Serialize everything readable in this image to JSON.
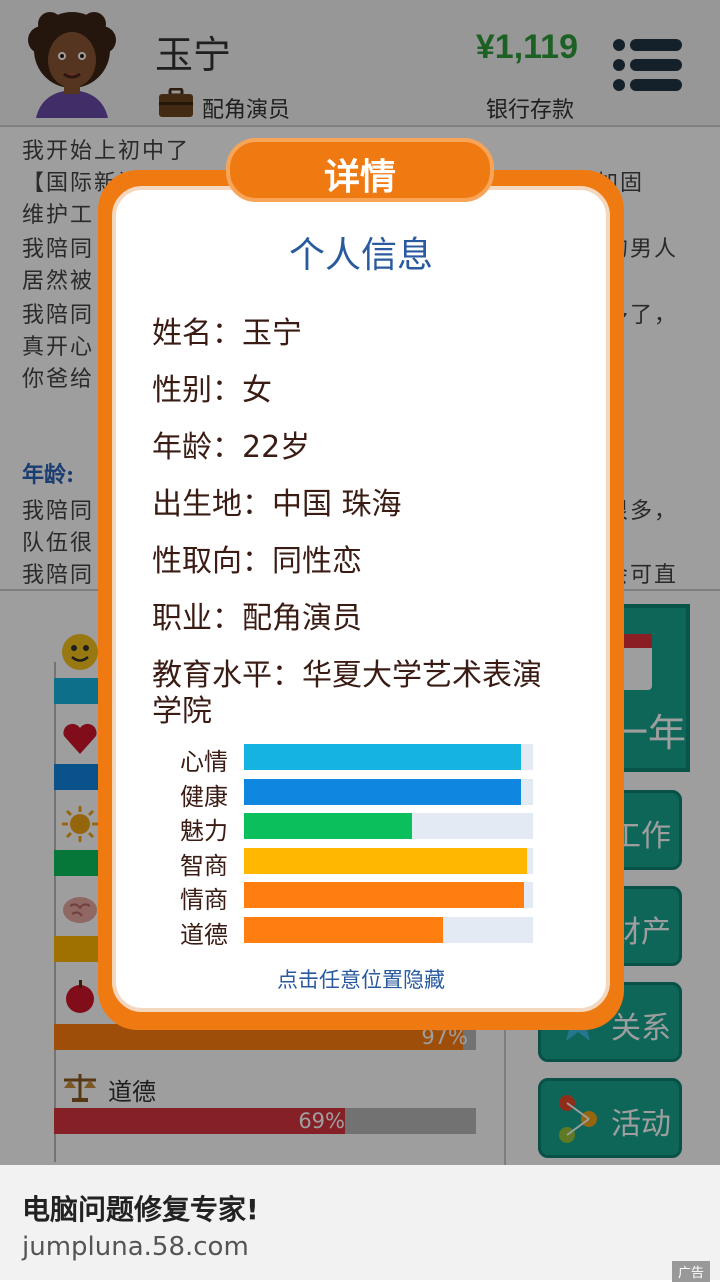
{
  "header": {
    "player_name": "玉宁",
    "job": "配角演员",
    "money": "¥1,119",
    "money_label": "银行存款"
  },
  "log": {
    "lines": [
      "我开始上初中了",
      "【国际新闻】",
      "维护工",
      "我陪同",
      "居然被",
      "我陪同",
      "真开心",
      "你爸给"
    ],
    "lines_right": [
      "乡桥梁加固",
      "的男人",
      "多了，"
    ],
    "age_heading": "年龄:",
    "lines2": [
      "我陪同",
      "队伍很",
      "我陪同"
    ],
    "lines2_right": [
      "很多，",
      "会可直"
    ]
  },
  "stats_panel": {
    "stats": [
      {
        "name": "心情",
        "icon": "smiley-icon",
        "value": 96,
        "color": "#15b3df"
      },
      {
        "name": "健康",
        "icon": "heart-icon",
        "value": 96,
        "color": "#0f86df"
      },
      {
        "name": "魅力",
        "icon": "sun-icon",
        "value": 58,
        "color": "#0bbf5d"
      },
      {
        "name": "智商",
        "icon": "brain-icon",
        "value": 98,
        "color": "#ffb700"
      },
      {
        "name": "情商",
        "icon": "apple-icon",
        "value": 97,
        "color": "#ff7e0f"
      },
      {
        "name": "道德",
        "icon": "scales-icon",
        "value": 69,
        "color": "#d8343f"
      }
    ],
    "visible_pcts": {
      "eq": "97%",
      "moral": "69%"
    },
    "moral_label": "道德"
  },
  "side_buttons": {
    "year": "一年",
    "work": "工作",
    "assets": "财产",
    "relations": "关系",
    "activities": "活动"
  },
  "dialog": {
    "tab": "详情",
    "title": "个人信息",
    "info": [
      "姓名：玉宁",
      "性别：女",
      "年龄：22岁",
      "出生地：中国 珠海",
      "性取向：同性恋",
      "职业：配角演员",
      "教育水平：华夏大学艺术表演",
      "学院"
    ],
    "stats": [
      {
        "name": "心情",
        "value": 96,
        "color": "#15b3df"
      },
      {
        "name": "健康",
        "value": 96,
        "color": "#0f86df"
      },
      {
        "name": "魅力",
        "value": 58,
        "color": "#0bbf5d"
      },
      {
        "name": "智商",
        "value": 98,
        "color": "#ffb700"
      },
      {
        "name": "情商",
        "value": 97,
        "color": "#ff7e0f"
      },
      {
        "name": "道德",
        "value": 69,
        "color": "#ff7e0f"
      }
    ],
    "hint": "点击任意位置隐藏"
  },
  "ad": {
    "title": "电脑问题修复专家!",
    "url": "jumpluna.58.com",
    "badge": "广告"
  }
}
